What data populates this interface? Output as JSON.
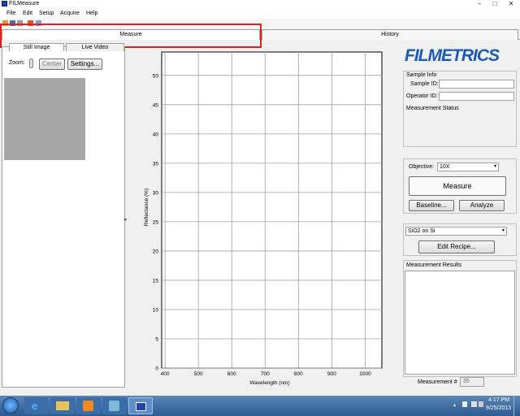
{
  "window": {
    "title": "FILMeasure",
    "controls": [
      "–",
      "□",
      "✕"
    ]
  },
  "menu": [
    "File",
    "Edit",
    "Setup",
    "Acquire",
    "Help"
  ],
  "tabs": {
    "measure": "Measure",
    "history": "History"
  },
  "left": {
    "subtabs": [
      "Still Image",
      "Live Video"
    ],
    "zoom_label": "Zoom:",
    "center_label": "Center",
    "settings_label": "Settings..."
  },
  "chart_data": {
    "type": "line",
    "xlabel": "Wavelength (nm)",
    "ylabel": "Reflectance (%)",
    "xlim": [
      390,
      1050
    ],
    "ylim": [
      0,
      54
    ],
    "xticks": [
      400,
      500,
      600,
      700,
      800,
      900,
      1000
    ],
    "yticks": [
      0,
      5,
      10,
      15,
      20,
      25,
      30,
      35,
      40,
      45,
      50
    ],
    "grid": true,
    "series": []
  },
  "right": {
    "logo": "FILMETRICS",
    "sample_info_label": "Sample Info",
    "sample_id_label": "Sample ID:",
    "sample_id_value": "",
    "operator_id_label": "Operator ID:",
    "operator_id_value": "",
    "measurement_status_label": "Measurement Status",
    "objective_label": "Objective:",
    "objective_value": "10X",
    "measure_label": "Measure",
    "baseline_label": "Baseline...",
    "analyze_label": "Analyze",
    "recipe_value": "SiO2 on Si",
    "edit_recipe_label": "Edit Recipe...",
    "results_label": "Measurement Results",
    "measurement_num_label": "Measurement #",
    "measurement_num_value": "35"
  },
  "taskbar": {
    "time": "4:17 PM",
    "date": "9/25/2013",
    "colors": {
      "start": "#1e90ff",
      "taskbar": "#3a6aa3"
    }
  }
}
